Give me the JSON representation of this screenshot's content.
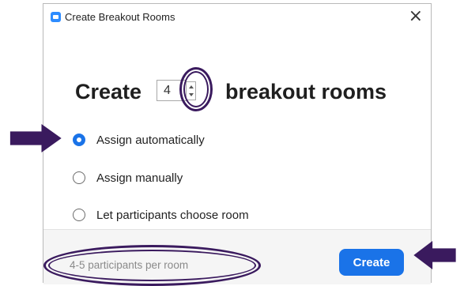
{
  "dialog": {
    "title": "Create Breakout Rooms",
    "close_symbol": "×",
    "icon": "app-icon"
  },
  "create_row": {
    "prefix": "Create",
    "count_value": "4",
    "suffix": "breakout rooms"
  },
  "options": [
    {
      "label": "Assign automatically",
      "selected": true
    },
    {
      "label": "Assign manually",
      "selected": false
    },
    {
      "label": "Let participants choose room",
      "selected": false
    }
  ],
  "footer": {
    "participants_text": "4-5 participants per room",
    "create_label": "Create"
  },
  "colors": {
    "accent": "#1a73e8",
    "annotation": "#3a1a5e"
  }
}
